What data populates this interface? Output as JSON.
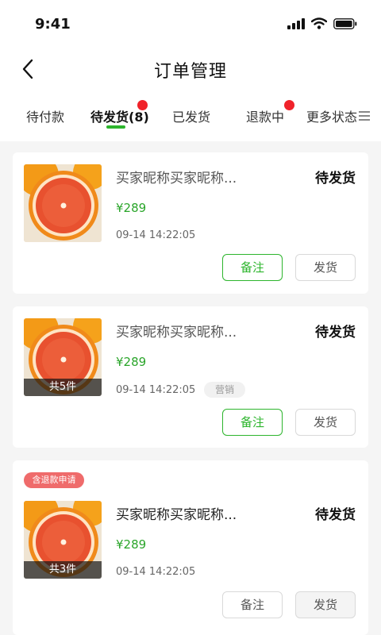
{
  "status_bar": {
    "time": "9:41"
  },
  "header": {
    "title": "订单管理",
    "back_icon": "chevron-left-icon"
  },
  "tabs": [
    {
      "label": "待付款",
      "active": false,
      "badge": false
    },
    {
      "label": "待发货(8)",
      "active": true,
      "badge": true
    },
    {
      "label": "已发货",
      "active": false,
      "badge": false
    },
    {
      "label": "退款中",
      "active": false,
      "badge": true
    },
    {
      "label": "更多状态",
      "active": false,
      "badge": false,
      "icon": "menu-icon"
    }
  ],
  "colors": {
    "accent": "#2db52d",
    "price": "#2aa52a",
    "badge": "#f0222a",
    "refund": "#ef6b6b"
  },
  "orders": [
    {
      "name": "买家昵称买家昵称...",
      "status": "待发货",
      "price": "¥289",
      "time": "09-14 14:22:05",
      "remark_label": "备注",
      "ship_label": "发货"
    },
    {
      "name": "买家昵称买家昵称...",
      "status": "待发货",
      "price": "¥289",
      "time": "09-14 14:22:05",
      "quantity": "共5件",
      "tag": "营销",
      "remark_label": "备注",
      "ship_label": "发货"
    },
    {
      "badge": "含退款申请",
      "name": "买家昵称买家昵称...",
      "status": "待发货",
      "price": "¥289",
      "time": "09-14 14:22:05",
      "quantity": "共3件",
      "remark_label": "备注",
      "ship_label": "发货"
    }
  ]
}
